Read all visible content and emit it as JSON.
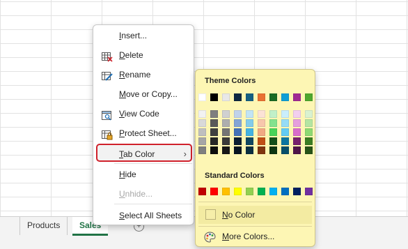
{
  "sheet_tabs": [
    {
      "label": "Products",
      "active": false
    },
    {
      "label": "Sales",
      "active": true
    }
  ],
  "add_sheet_icon": "plus-circle-icon",
  "context_menu": {
    "items": [
      {
        "label": "Insert...",
        "icon": "none",
        "enabled": true
      },
      {
        "label": "Delete",
        "icon": "delete-sheet-icon",
        "enabled": true
      },
      {
        "label": "Rename",
        "icon": "rename-sheet-icon",
        "enabled": true
      },
      {
        "label": "Move or Copy...",
        "icon": "none",
        "enabled": true
      },
      {
        "label": "View Code",
        "icon": "view-code-icon",
        "enabled": true
      },
      {
        "label": "Protect Sheet...",
        "icon": "protect-sheet-icon",
        "enabled": true
      },
      {
        "label": "Tab Color",
        "icon": "none",
        "enabled": true,
        "has_submenu": true,
        "highlighted": true
      },
      {
        "label": "Hide",
        "icon": "none",
        "enabled": true
      },
      {
        "label": "Unhide...",
        "icon": "none",
        "enabled": false
      },
      {
        "label": "Select All Sheets",
        "icon": "none",
        "enabled": true
      }
    ],
    "submenu_chevron": "›"
  },
  "tab_color_menu": {
    "theme_title": "Theme Colors",
    "theme_top_row": [
      "#FFFFFF",
      "#000000",
      "#E8E8E8",
      "#0E2841",
      "#156082",
      "#E97132",
      "#196B24",
      "#0F9ED5",
      "#A02B93",
      "#4EA72E"
    ],
    "theme_shades": [
      [
        "#F2F2F2",
        "#7F7F7F",
        "#D0D0D0",
        "#C0D2EA",
        "#C1E4F5",
        "#FBE2D5",
        "#C1F0C8",
        "#CAEEFB",
        "#F2CEEF",
        "#D9F2D0"
      ],
      [
        "#D9D9D9",
        "#595959",
        "#AEAEAE",
        "#83A5D6",
        "#83CBEB",
        "#F7C7AC",
        "#83E28E",
        "#95DCF7",
        "#E59EDD",
        "#B4E5A2"
      ],
      [
        "#BFBFBF",
        "#404040",
        "#757575",
        "#4472B7",
        "#44B3E1",
        "#F1A983",
        "#47D359",
        "#61CBF3",
        "#D86DCB",
        "#8ED973"
      ],
      [
        "#A6A6A6",
        "#262626",
        "#3A3A3A",
        "#0B1E31",
        "#0F4761",
        "#C04F15",
        "#124F1A",
        "#0B76A0",
        "#77206D",
        "#3A7D22"
      ],
      [
        "#7F7F7F",
        "#0D0D0D",
        "#171717",
        "#071420",
        "#0A2F40",
        "#80350E",
        "#0C3511",
        "#074F6A",
        "#501549",
        "#275317"
      ]
    ],
    "standard_title": "Standard Colors",
    "standard_colors": [
      "#C00000",
      "#FF0000",
      "#FFC000",
      "#FFFF00",
      "#92D050",
      "#00B050",
      "#00B0F0",
      "#0070C0",
      "#002060",
      "#7030A0"
    ],
    "no_color_label": "No Color",
    "more_colors_label": "More Colors..."
  }
}
